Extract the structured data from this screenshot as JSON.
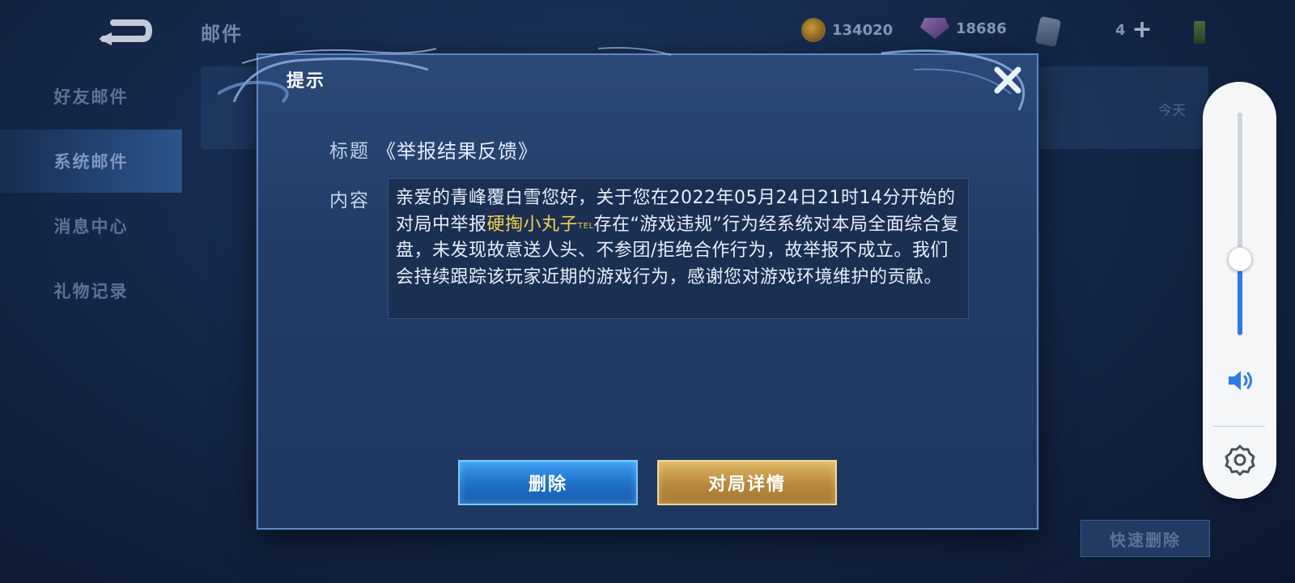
{
  "header": {
    "page_title": "邮件",
    "gold": "134020",
    "gems": "18686",
    "card_count": "4"
  },
  "sidebar": {
    "items": [
      {
        "label": "好友邮件"
      },
      {
        "label": "系统邮件"
      },
      {
        "label": "消息中心"
      },
      {
        "label": "礼物记录"
      }
    ]
  },
  "mail_list": {
    "date": "今天",
    "quick_delete_label": "快速删除"
  },
  "modal": {
    "title": "提示",
    "title_label": "标题",
    "subject": "《举报结果反馈》",
    "content_label": "内容",
    "content_before": "亲爱的青峰覆白雪您好，关于您在2022年05月24日21时14分开始的对局中举报",
    "reported_player": "硬掏小丸子",
    "player_tag": "TEL",
    "content_after": "存在“游戏违规”行为经系统对本局全面综合复盘，未发现故意送人头、不参团/拒绝合作行为，故举报不成立。我们会持续跟踪该玩家近期的游戏行为，感谢您对游戏环境维护的贡献。",
    "delete_label": "删除",
    "details_label": "对局详情"
  },
  "volume": {
    "level": 0.34,
    "icon": "speaker-icon",
    "settings_icon": "gear-icon"
  },
  "colors": {
    "accent_blue": "#2f7be5",
    "highlight_name": "#f2d24a",
    "gold_button": "#c99a45",
    "blue_button": "#2b87dd"
  }
}
